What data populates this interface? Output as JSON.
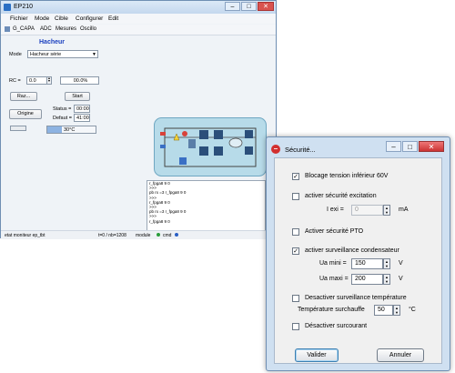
{
  "main_window": {
    "title": "EP210",
    "window_buttons": {
      "minimize": "–",
      "maximize": "□",
      "close": "✕"
    },
    "menu": [
      "Fichier",
      "Mode",
      "Cible",
      "Configurer",
      "Edit"
    ],
    "toolbar": [
      "G_CAPA",
      "ADC",
      "Mesures",
      "Oscillo"
    ],
    "panel_title": "Hacheur",
    "mode_label": "Mode",
    "mode_value": "Hacheur série",
    "rc_label": "RC =",
    "rc_value": "0.0",
    "rc_percent": "00.0%",
    "raz_button": "Raz...",
    "start_button": "Start",
    "origine_button": "Origine",
    "status_label": "Status =",
    "status_value": "00:00",
    "defaut_label": "Defaut =",
    "defaut_value": "41:00",
    "temperature": "30°C",
    "log_lines": [
      "r_fpga8 9 0",
      ">>>",
      "pb rx =3 r_fpga8 9 0",
      ">>>",
      "r_fpga8 9 0",
      ">>>",
      "pb rx =3 r_fpga8 9 0",
      ">>>",
      "r_fpga8 9 0"
    ],
    "statusbar": {
      "left": "etat moniteur ep_tbt",
      "middle": "t=0 / nb=1208",
      "module": "module",
      "cmd": "cmd"
    }
  },
  "dialog": {
    "title": "Sécurité...",
    "window_buttons": {
      "minimize": "–",
      "maximize": "□",
      "close": "✕"
    },
    "blocage_label": "Blocage tension inférieur 60V",
    "blocage_checked": true,
    "excitation_label": "activer sécurité excitation",
    "excitation_checked": false,
    "iexi_label": "I exi =",
    "iexi_value": "0",
    "iexi_unit": "mA",
    "pto_label": "Activer sécurité PTO",
    "pto_checked": false,
    "condensateur_label": "activer surveillance condensateur",
    "condensateur_checked": true,
    "ua_mini_label": "Ua mini =",
    "ua_mini_value": "150",
    "ua_mini_unit": "V",
    "ua_maxi_label": "Ua maxi =",
    "ua_maxi_value": "200",
    "ua_maxi_unit": "V",
    "temp_surv_label": "Desactiver surveillance température",
    "temp_surv_checked": false,
    "surchauffe_label": "Température surchauffe",
    "surchauffe_value": "50",
    "surchauffe_unit": "°C",
    "surcourant_label": "Désactiver surcourant",
    "surcourant_checked": false,
    "valider_button": "Valider",
    "annuler_button": "Annuler"
  }
}
